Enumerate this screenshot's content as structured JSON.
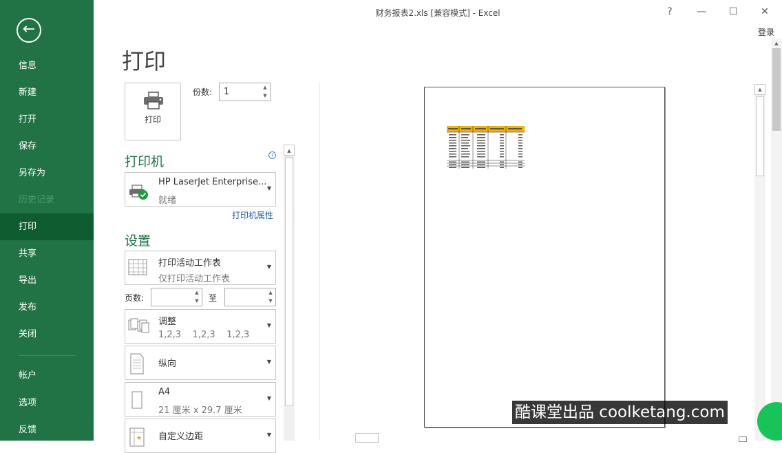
{
  "window": {
    "title": "财务报表2.xls  [兼容模式] - Excel",
    "help": "?",
    "minimize": "—",
    "maximize": "☐",
    "close": "✕",
    "signin": "登录"
  },
  "nav": {
    "back": "←",
    "items": [
      {
        "label": "信息"
      },
      {
        "label": "新建"
      },
      {
        "label": "打开"
      },
      {
        "label": "保存"
      },
      {
        "label": "另存为"
      },
      {
        "label": "历史记录"
      },
      {
        "label": "打印"
      },
      {
        "label": "共享"
      },
      {
        "label": "导出"
      },
      {
        "label": "发布"
      },
      {
        "label": "关闭"
      },
      {
        "label": "帐户"
      },
      {
        "label": "选项"
      },
      {
        "label": "反馈"
      }
    ],
    "active": "打印",
    "disabled": "历史记录"
  },
  "page_title": "打印",
  "print_button": {
    "label": "打印",
    "icon": "printer-icon"
  },
  "copies": {
    "label": "份数:",
    "value": "1"
  },
  "printer_section": {
    "heading": "打印机",
    "info_icon": "i",
    "printer_name": "HP LaserJet Enterprise...",
    "printer_status": "就绪",
    "properties_link": "打印机属性"
  },
  "settings_section": {
    "heading": "设置",
    "scope": {
      "main": "打印活动工作表",
      "sub": "仅打印活动工作表"
    },
    "pages": {
      "label": "页数:",
      "from": "",
      "to_label": "至",
      "to": ""
    },
    "collate": {
      "main": "调整",
      "sub": "1,2,3    1,2,3    1,2,3"
    },
    "orientation": {
      "main": "纵向"
    },
    "paper": {
      "main": "A4",
      "sub": "21 厘米 x 29.7 厘米"
    },
    "margins": {
      "main": "自定义边距"
    }
  },
  "watermark": "酷课堂出品 coolketang.com",
  "colors": {
    "accent": "#217346",
    "active_nav": "#0e5c2f",
    "header_fill": "#f6b100"
  }
}
